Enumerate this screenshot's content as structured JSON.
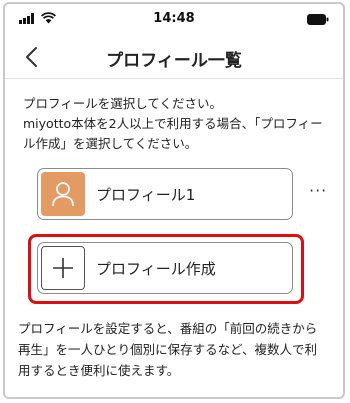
{
  "status_bar": {
    "time": "14:48",
    "icons": [
      "signal-icon",
      "wifi-icon",
      "battery-icon"
    ]
  },
  "nav": {
    "title": "プロフィール一覧",
    "back_icon": "chevron-left-icon"
  },
  "intro": {
    "lines": [
      "プロフィールを選択してください。",
      "miyotto本体を2人以上で利用する場合、「プロフィー",
      "ル作成」を選択してください。"
    ]
  },
  "profiles": [
    {
      "label": "プロフィール1",
      "avatar_icon": "user-icon",
      "avatar_color": "#e49a63"
    }
  ],
  "more_menu": {
    "label": "···"
  },
  "create": {
    "label": "プロフィール作成",
    "icon": "plus-icon"
  },
  "highlight_color": "#e00f0f",
  "note": {
    "lines": [
      "プロフィールを設定すると、番組の「前回の続きから",
      "再生」を一人ひとり個別に保存するなど、複数人で利",
      "用するとき便利に使えます。"
    ]
  }
}
